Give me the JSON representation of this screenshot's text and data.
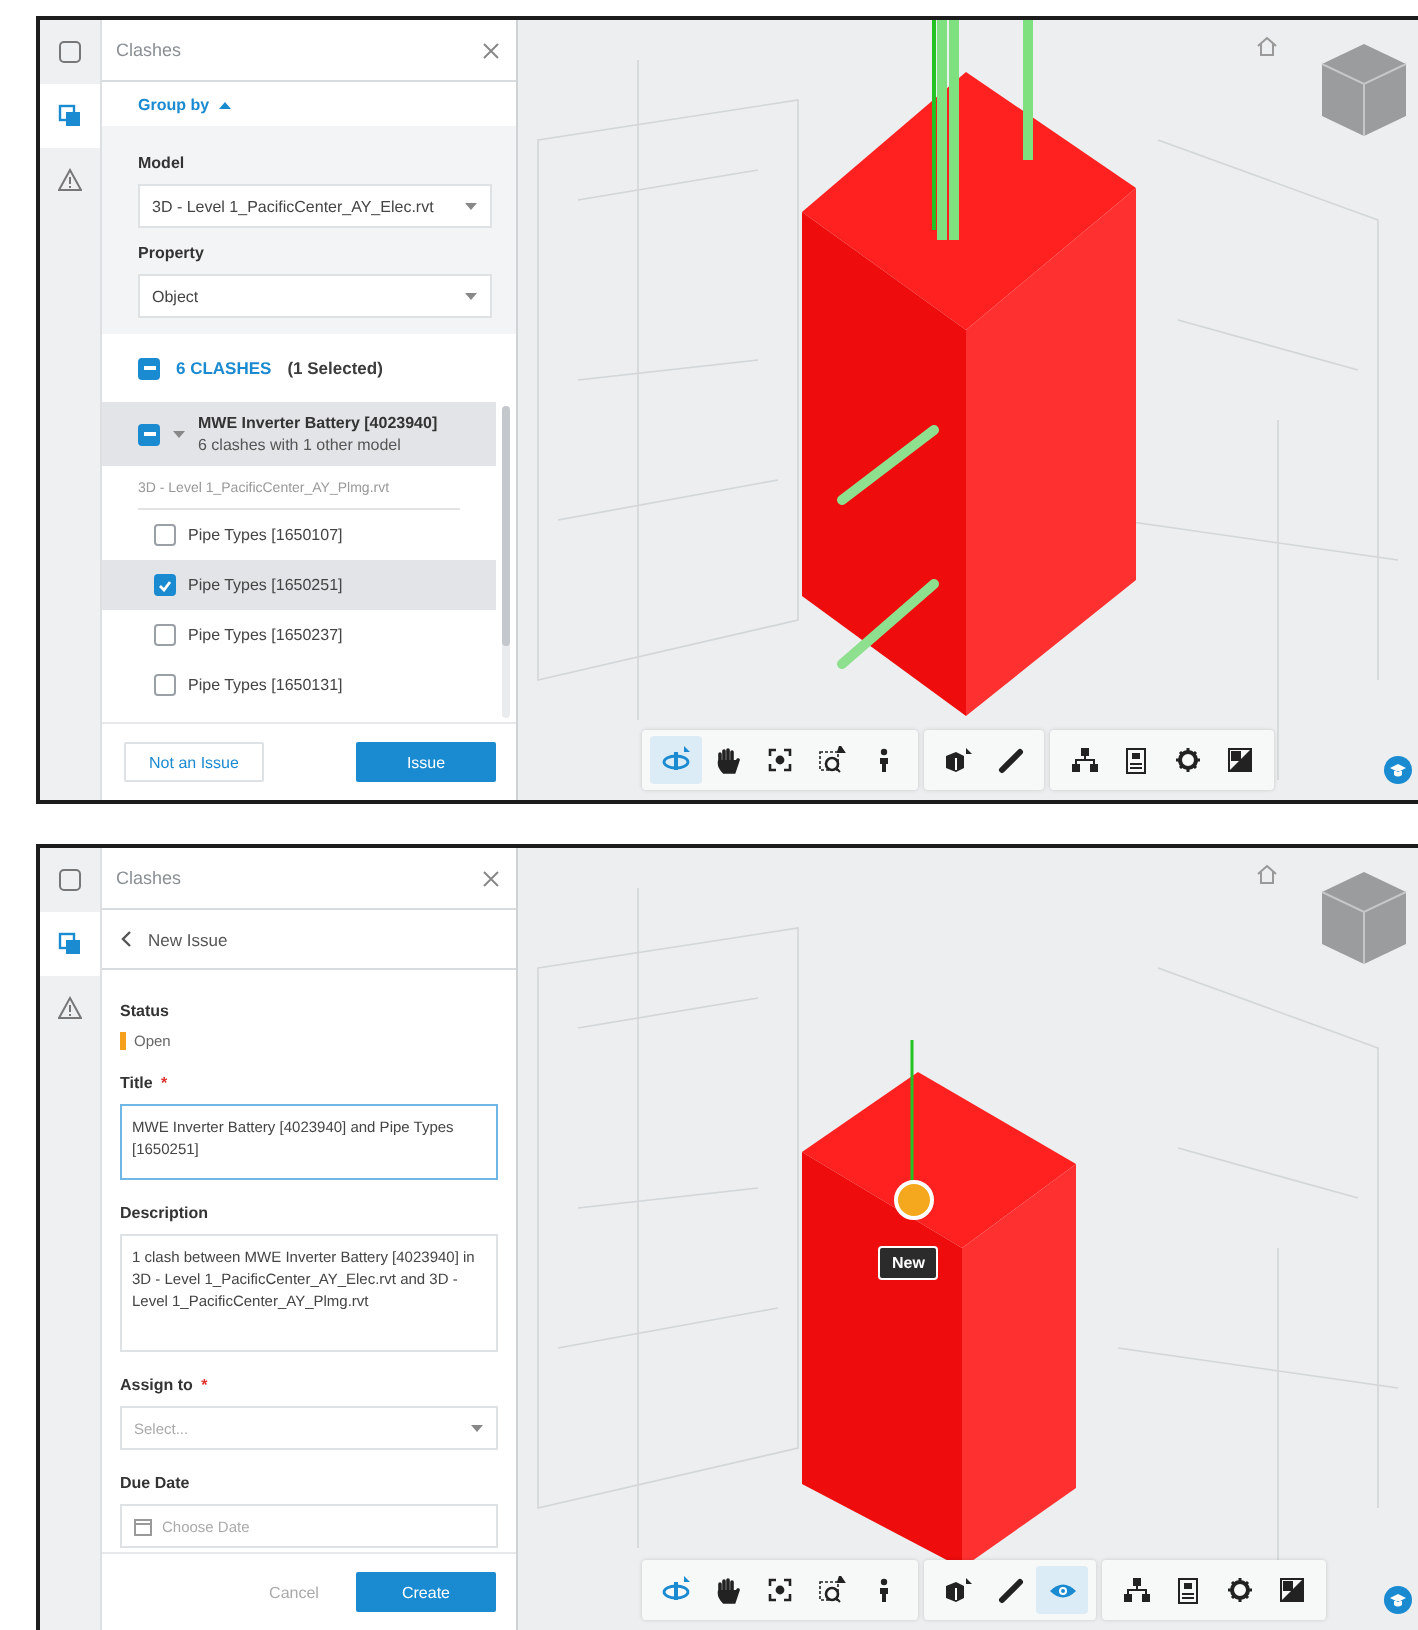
{
  "screens": [
    {
      "rail": [
        {
          "kind": "box",
          "selected": false
        },
        {
          "kind": "clashes",
          "selected": true
        },
        {
          "kind": "warning",
          "selected": false
        }
      ],
      "panel": {
        "kind": "clash_list",
        "title": "Clashes",
        "group_by": {
          "label": "Group by",
          "expanded": true
        },
        "options": [
          {
            "label": "Model",
            "value": "3D - Level 1_PacificCenter_AY_Elec.rvt"
          },
          {
            "label": "Property",
            "value": "Object"
          }
        ],
        "summary": {
          "count": "6 CLASHES",
          "selection": "(1 Selected)",
          "indeterminate": true
        },
        "group": {
          "title": "MWE Inverter Battery [4023940]",
          "subtitle": "6 clashes with 1 other model",
          "indeterminate": true,
          "expanded": true,
          "model": "3D - Level 1_PacificCenter_AY_Plmg.rvt",
          "items": [
            {
              "label": "Pipe Types [1650107]",
              "checked": false,
              "selected": false
            },
            {
              "label": "Pipe Types [1650251]",
              "checked": true,
              "selected": true
            },
            {
              "label": "Pipe Types [1650237]",
              "checked": false,
              "selected": false
            },
            {
              "label": "Pipe Types [1650131]",
              "checked": false,
              "selected": false
            }
          ]
        },
        "buttons": [
          {
            "label": "Not an Issue",
            "kind": "secondary"
          },
          {
            "label": "Issue",
            "kind": "primary"
          }
        ]
      },
      "viewer": {
        "kind": "pipes"
      },
      "toolbar": [
        [
          {
            "kind": "orbit",
            "active": true
          },
          {
            "kind": "pan",
            "active": false
          },
          {
            "kind": "fit",
            "active": false
          },
          {
            "kind": "zoom",
            "active": false
          },
          {
            "kind": "walk",
            "active": false
          }
        ],
        [
          {
            "kind": "explode",
            "active": false
          },
          {
            "kind": "measure",
            "active": false
          }
        ],
        [
          {
            "kind": "tree",
            "active": false
          },
          {
            "kind": "properties",
            "active": false
          },
          {
            "kind": "settings",
            "active": false
          },
          {
            "kind": "fullscreen",
            "active": false
          }
        ]
      ]
    },
    {
      "rail": [
        {
          "kind": "box",
          "selected": false
        },
        {
          "kind": "clashes",
          "selected": true
        },
        {
          "kind": "warning",
          "selected": false
        }
      ],
      "panel": {
        "kind": "issue_form",
        "title": "Clashes",
        "back_label": "New Issue",
        "fields": [
          {
            "kind": "status",
            "label": "Status",
            "value": "Open",
            "color": "#f5a01e"
          },
          {
            "kind": "textarea",
            "label": "Title",
            "required_mark": "*",
            "value": "MWE Inverter Battery [4023940] and Pipe Types [1650251]",
            "focused": true
          },
          {
            "kind": "textarea",
            "label": "Description",
            "value": "1 clash between MWE Inverter Battery [4023940] in 3D - Level 1_PacificCenter_AY_Elec.rvt and 3D - Level 1_PacificCenter_AY_Plmg.rvt",
            "focused": false
          },
          {
            "kind": "select",
            "label": "Assign to",
            "required_mark": "*",
            "placeholder": "Select..."
          },
          {
            "kind": "date",
            "label": "Due Date",
            "placeholder": "Choose Date"
          }
        ],
        "buttons": [
          {
            "label": "Cancel",
            "kind": "text"
          },
          {
            "label": "Create",
            "kind": "primary"
          }
        ]
      },
      "viewer": {
        "kind": "pin",
        "pin_label": "New"
      },
      "toolbar": [
        [
          {
            "kind": "orbit",
            "active": false
          },
          {
            "kind": "pan",
            "active": false
          },
          {
            "kind": "fit",
            "active": false
          },
          {
            "kind": "zoom",
            "active": false
          },
          {
            "kind": "walk",
            "active": false
          }
        ],
        [
          {
            "kind": "explode",
            "active": false
          },
          {
            "kind": "measure",
            "active": false
          },
          {
            "kind": "eye",
            "active": true
          }
        ],
        [
          {
            "kind": "tree",
            "active": false
          },
          {
            "kind": "properties",
            "active": false
          },
          {
            "kind": "settings",
            "active": false
          },
          {
            "kind": "fullscreen",
            "active": false
          }
        ]
      ]
    }
  ]
}
